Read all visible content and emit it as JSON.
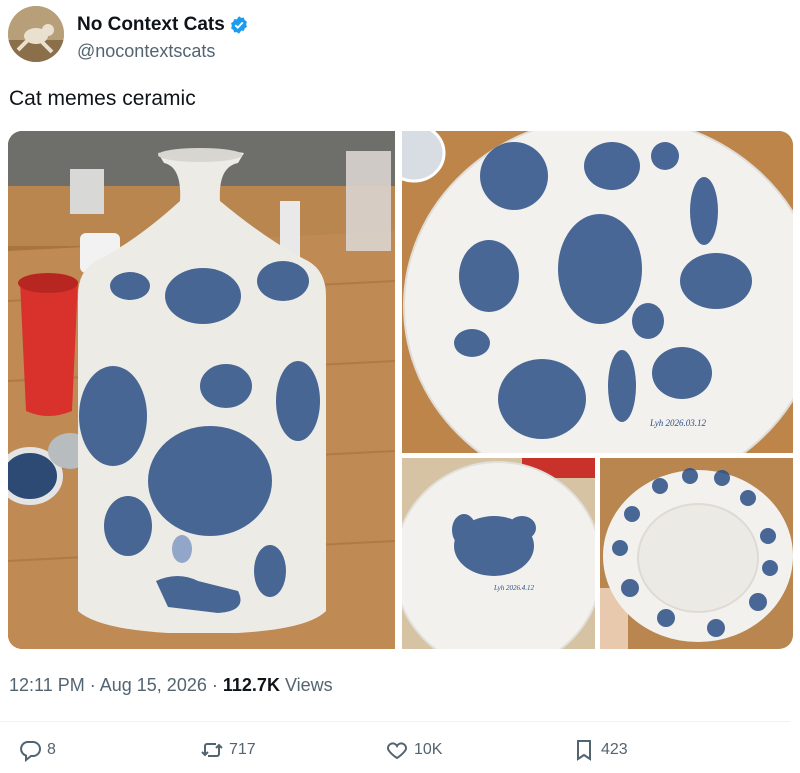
{
  "author": {
    "display_name": "No Context Cats",
    "handle": "@nocontextscats"
  },
  "tweet": {
    "text": "Cat memes ceramic",
    "time": "12:11 PM",
    "separator": "·",
    "date": "Aug 15, 2026",
    "views_count": "112.7K",
    "views_label": "Views"
  },
  "media": {
    "signature_main": "Lyh 2026.03.12",
    "signature_small": "Lyh 2026.4.12"
  },
  "actions": {
    "replies": "8",
    "reposts": "717",
    "likes": "10K",
    "bookmarks": "423"
  },
  "colors": {
    "verified": "#1d9bf0",
    "muted_text": "#536471",
    "cobalt": "#2b4f86"
  }
}
